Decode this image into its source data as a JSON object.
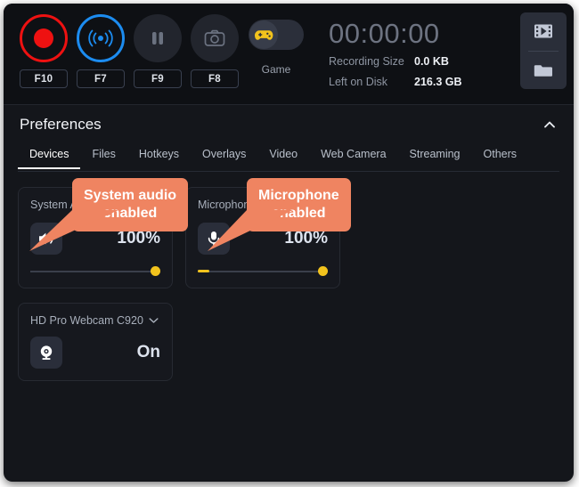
{
  "toolbar": {
    "controls": [
      {
        "name": "record",
        "icon": "record-icon",
        "hotkey": "F10"
      },
      {
        "name": "stream",
        "icon": "broadcast-icon",
        "hotkey": "F7"
      },
      {
        "name": "pause",
        "icon": "pause-icon",
        "hotkey": "F9"
      },
      {
        "name": "screenshot",
        "icon": "camera-icon",
        "hotkey": "F8"
      }
    ],
    "game_toggle": {
      "label": "Game",
      "icon": "gamepad-icon",
      "state": "off"
    },
    "timer": "00:00:00",
    "stats": [
      {
        "label": "Recording Size",
        "value": "0.0 KB"
      },
      {
        "label": "Left on Disk",
        "value": "216.3 GB"
      }
    ],
    "side_buttons": [
      {
        "name": "media-library",
        "icon": "film-icon"
      },
      {
        "name": "open-folder",
        "icon": "folder-icon"
      }
    ]
  },
  "preferences": {
    "title": "Preferences",
    "collapse_icon": "chevron-up-icon",
    "tabs": [
      {
        "label": "Devices",
        "active": true
      },
      {
        "label": "Files",
        "active": false
      },
      {
        "label": "Hotkeys",
        "active": false
      },
      {
        "label": "Overlays",
        "active": false
      },
      {
        "label": "Video",
        "active": false
      },
      {
        "label": "Web Camera",
        "active": false
      },
      {
        "label": "Streaming",
        "active": false
      },
      {
        "label": "Others",
        "active": false
      }
    ]
  },
  "devices": {
    "system_audio": {
      "title": "System Audio",
      "icon": "speaker-icon",
      "volume": "100%",
      "level_visible": false
    },
    "microphone": {
      "title": "Microphone",
      "icon": "microphone-icon",
      "volume": "100%",
      "level_visible": true
    },
    "webcam": {
      "title": "HD Pro Webcam C920",
      "dropdown_icon": "chevron-down-icon",
      "icon": "webcam-icon",
      "state": "On"
    }
  },
  "callouts": [
    {
      "name": "system-audio-enabled",
      "line1": "System audio",
      "line2": "enabled"
    },
    {
      "name": "microphone-enabled",
      "line1": "Microphone",
      "line2": "enabled"
    }
  ],
  "colors": {
    "record_red": "#ee1111",
    "stream_blue": "#1c8cf0",
    "accent_yellow": "#f2c31d",
    "callout_orange": "#ef8461",
    "app_bg": "#14161b"
  }
}
